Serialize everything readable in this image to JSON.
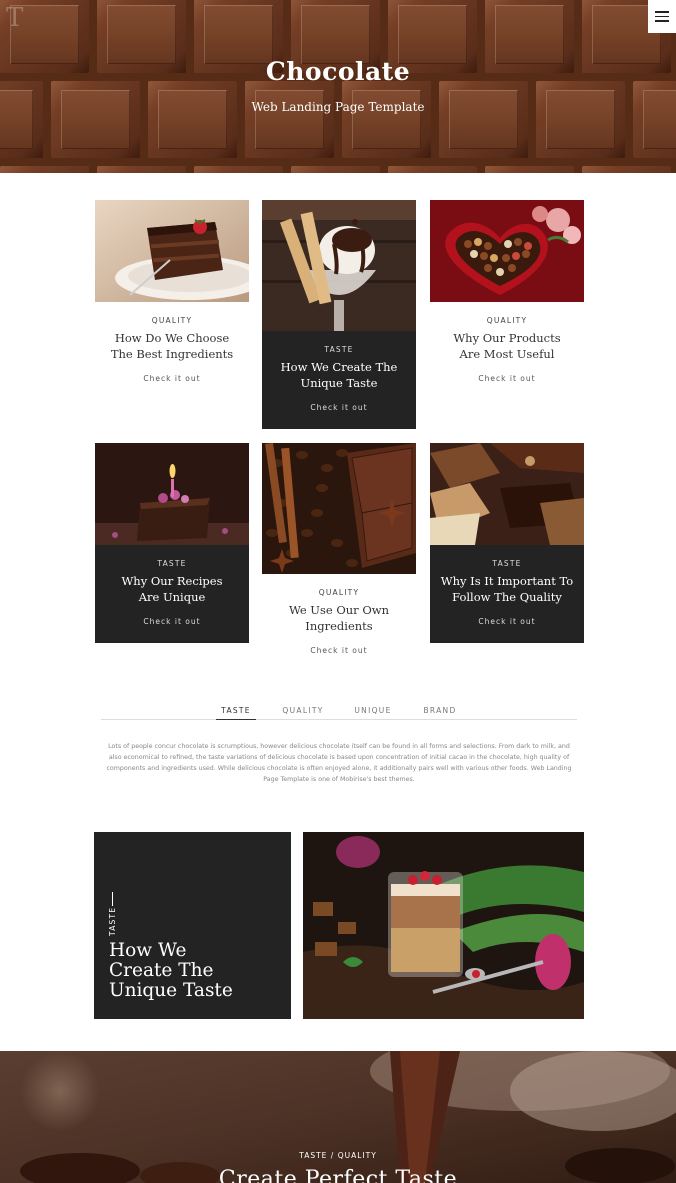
{
  "hero": {
    "logo_letter": "T",
    "title": "Chocolate",
    "subtitle": "Web Landing Page Template"
  },
  "cards": [
    {
      "category": "QUALITY",
      "title_line1": "How Do We Choose",
      "title_line2": "The Best Ingredients",
      "link": "Check it out",
      "image": "chocolate-cake-slice"
    },
    {
      "category": "TASTE",
      "title_line1": "How We Create The",
      "title_line2": "Unique Taste",
      "link": "Check it out",
      "image": "chocolate-ice-cream-sundae"
    },
    {
      "category": "QUALITY",
      "title_line1": "Why Our Products",
      "title_line2": "Are Most Useful",
      "link": "Check it out",
      "image": "heart-chocolate-box"
    },
    {
      "category": "TASTE",
      "title_line1": "Why Our Recipes",
      "title_line2": "Are Unique",
      "link": "Check it out",
      "image": "birthday-cake-candle"
    },
    {
      "category": "QUALITY",
      "title_line1": "We Use Our Own",
      "title_line2": "Ingredients",
      "link": "Check it out",
      "image": "cinnamon-coffee-beans-chocolate"
    },
    {
      "category": "TASTE",
      "title_line1": "Why Is It Important To",
      "title_line2": "Follow The Quality",
      "link": "Check it out",
      "image": "broken-chocolate-pieces"
    }
  ],
  "tabs": {
    "items": [
      "TASTE",
      "QUALITY",
      "UNIQUE",
      "BRAND"
    ],
    "active": "TASTE",
    "content_line1": "Lots of people concur chocolate is scrumptious, however delicious chocolate itself can be found in all forms and selections. From dark to milk, and",
    "content_line2": "also economical to refined, the taste variations of delicious chocolate is based upon concentration of initial cacao in the chocolate, high quality of",
    "content_line3": "components and ingredients used. While delicious chocolate is often enjoyed alone, it additionally pairs well with various other foods. Web Landing",
    "content_line4": "Page Template is one of Mobirise's best themes."
  },
  "feature": {
    "category": "TASTE",
    "title_line1": "How We",
    "title_line2": "Create The",
    "title_line3": "Unique Taste"
  },
  "banner": {
    "category": "TASTE / QUALITY",
    "title": "Create Perfect Taste"
  },
  "colors": {
    "dark_card": "#232323",
    "chocolate": "#6b3a22"
  }
}
